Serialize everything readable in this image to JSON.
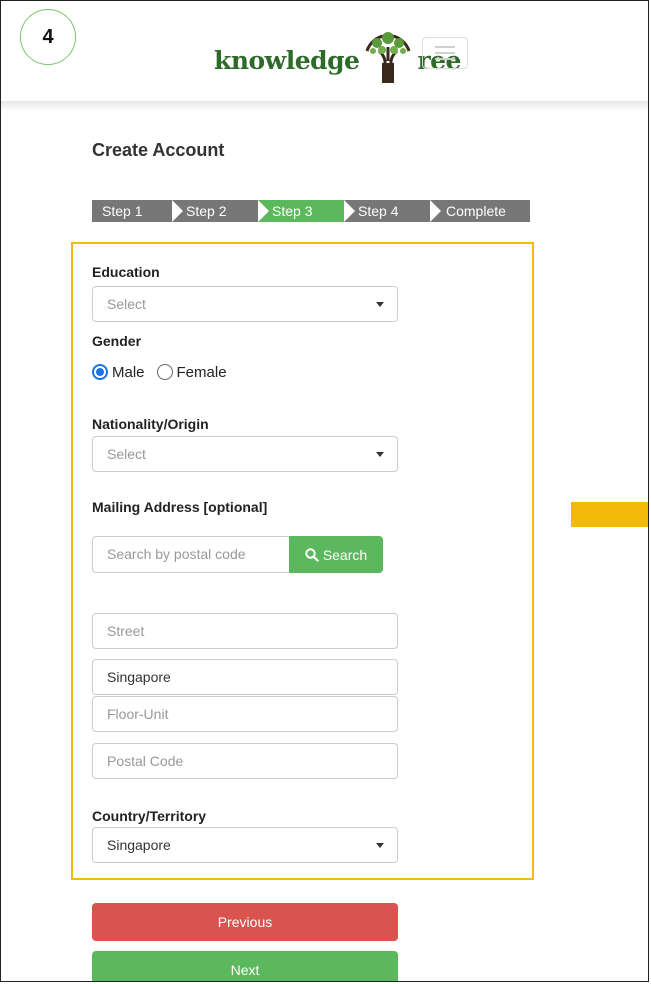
{
  "step_badge": "4",
  "header": {
    "logo_text_left": "knowledge",
    "logo_text_right": "ree",
    "menu_icon": "hamburger-menu-icon"
  },
  "page_title": "Create Account",
  "steps": [
    {
      "label": "Step 1",
      "active": false
    },
    {
      "label": "Step 2",
      "active": false
    },
    {
      "label": "Step 3",
      "active": true
    },
    {
      "label": "Step 4",
      "active": false
    },
    {
      "label": "Complete",
      "active": false
    }
  ],
  "form": {
    "education": {
      "label": "Education",
      "value": "Select"
    },
    "gender": {
      "label": "Gender",
      "options": [
        "Male",
        "Female"
      ],
      "selected": "Male"
    },
    "nationality": {
      "label": "Nationality/Origin",
      "value": "Select"
    },
    "mailing": {
      "label": "Mailing Address [optional]",
      "search_placeholder": "Search by postal code",
      "search_button": "Search",
      "street_placeholder": "Street",
      "city_value": "Singapore",
      "floor_placeholder": "Floor-Unit",
      "postal_placeholder": "Postal Code"
    },
    "country": {
      "label": "Country/Territory",
      "value": "Singapore"
    }
  },
  "buttons": {
    "previous": "Previous",
    "next": "Next"
  },
  "colors": {
    "accent_green": "#5cb85c",
    "danger_red": "#d9534f",
    "highlight_yellow": "#f5b90b",
    "step_gray": "#777777"
  }
}
